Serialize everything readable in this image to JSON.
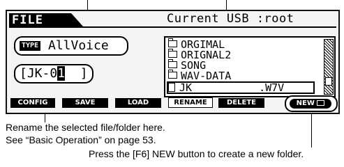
{
  "screen": {
    "title": "FILE",
    "location": "Current USB :root",
    "type_badge": "TYPE",
    "type_value": "AllVoice",
    "name_prefix": "[JK-0",
    "name_cursor": "1",
    "name_suffix": "  ]"
  },
  "file_list": [
    {
      "name": "ORGIMAL",
      "kind": "folder"
    },
    {
      "name": "ORIGNAL2",
      "kind": "folder"
    },
    {
      "name": "SONG",
      "kind": "folder"
    },
    {
      "name": "WAV-DATA",
      "kind": "folder"
    },
    {
      "name": "JK",
      "ext": ".W7V",
      "kind": "file",
      "selected": true
    }
  ],
  "function_keys": {
    "f1": "CONFIG",
    "f2": "SAVE",
    "f3": "LOAD",
    "f4": "RENAME",
    "f5": "DELETE",
    "f6": "NEW"
  },
  "annotations": {
    "rename_line1": "Rename the selected file/folder here.",
    "rename_line2": "See “Basic Operation” on page 53.",
    "new_folder": "Press the [F6] NEW button to create a new folder."
  }
}
